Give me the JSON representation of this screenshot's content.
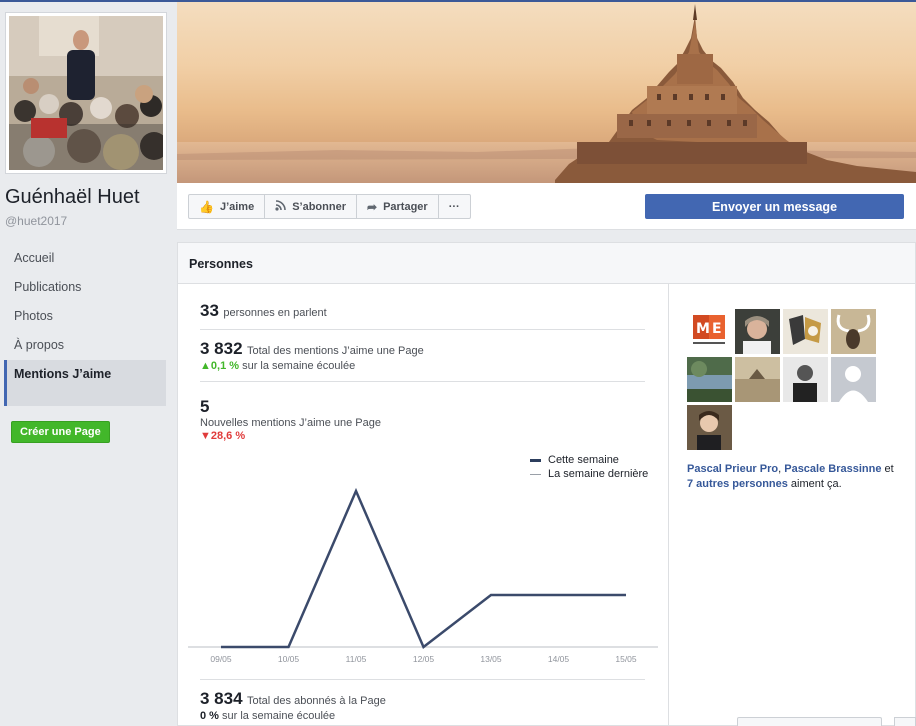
{
  "page": {
    "name": "Guénhaël Huet",
    "handle": "@huet2017"
  },
  "nav": {
    "items": [
      {
        "label": "Accueil"
      },
      {
        "label": "Publications"
      },
      {
        "label": "Photos"
      },
      {
        "label": "À propos"
      },
      {
        "label": "Mentions J’aime"
      }
    ],
    "create_page": "Créer une Page"
  },
  "actions": {
    "like": "J’aime",
    "subscribe": "S’abonner",
    "share": "Partager",
    "more": "···",
    "send_message": "Envoyer un message"
  },
  "panel": {
    "title": "Personnes",
    "talking": {
      "value": "33",
      "label": "personnes en parlent"
    },
    "total_likes": {
      "value": "3 832",
      "label": "Total des mentions J’aime une Page",
      "change": "0,1 %",
      "change_suffix": "sur la semaine écoulée",
      "direction": "up"
    },
    "new_likes": {
      "value": "5",
      "label": "Nouvelles mentions J’aime une Page",
      "change": "28,6 %",
      "direction": "down"
    },
    "followers": {
      "value": "3 834",
      "label": "Total des abonnés à la Page",
      "change": "0 %",
      "change_suffix": "sur la semaine écoulée"
    }
  },
  "legend": {
    "this_week": "Cette semaine",
    "last_week": "La semaine dernière"
  },
  "chart_data": {
    "type": "line",
    "x": [
      "09/05",
      "10/05",
      "11/05",
      "12/05",
      "13/05",
      "14/05",
      "15/05"
    ],
    "series": [
      {
        "name": "Cette semaine",
        "values": [
          0,
          0,
          3,
          0,
          1,
          1,
          1
        ],
        "color": "#3b4a6b"
      }
    ],
    "ylim": [
      0,
      3
    ]
  },
  "likers": {
    "text_prefix": "",
    "name1": "Pascal Prieur Pro",
    "sep": ", ",
    "name2": "Pascale Brassinne",
    "and": " et ",
    "others": "7 autres personnes",
    "suffix": " aiment ça."
  },
  "colors": {
    "brand": "#4267b2",
    "up": "#42b72a",
    "down": "#e03b3b"
  }
}
